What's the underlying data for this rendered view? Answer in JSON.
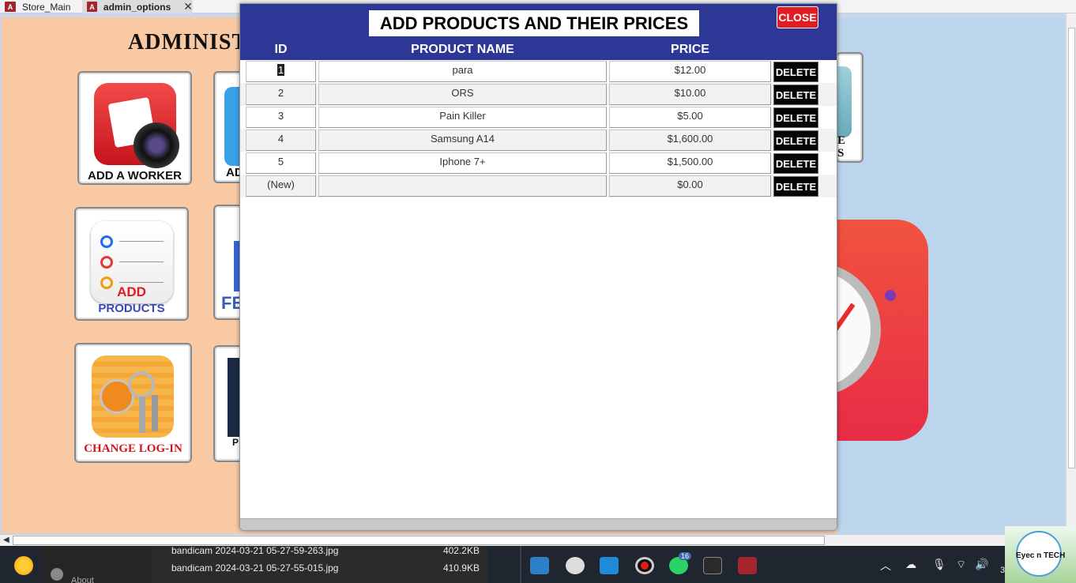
{
  "tabs": [
    {
      "label": "Store_Main",
      "icon": "access-icon"
    },
    {
      "label": "admin_options",
      "icon": "access-icon",
      "active": true
    }
  ],
  "background": {
    "title": "ADMINIST",
    "tiles": [
      {
        "label": "ADD A WORKER"
      },
      {
        "label": "AD"
      },
      {
        "label_line1": "ADD",
        "label_line2": "PRODUCTS"
      },
      {
        "label": "FE"
      },
      {
        "label": "CHANGE LOG-IN"
      },
      {
        "label": "P"
      },
      {
        "label_line1": "E",
        "label_line2": "S"
      }
    ]
  },
  "popup": {
    "title": "ADD PRODUCTS AND THEIR PRICES",
    "close_label": "CLOSE",
    "columns": {
      "id": "ID",
      "name": "PRODUCT NAME",
      "price": "PRICE"
    },
    "delete_label": "DELETE",
    "rows": [
      {
        "id": "1",
        "name": "para",
        "price": "$12.00"
      },
      {
        "id": "2",
        "name": "ORS",
        "price": "$10.00"
      },
      {
        "id": "3",
        "name": "Pain Killer",
        "price": "$5.00"
      },
      {
        "id": "4",
        "name": "Samsung A14",
        "price": "$1,600.00"
      },
      {
        "id": "5",
        "name": "Iphone 7+",
        "price": "$1,500.00"
      },
      {
        "id": "(New)",
        "name": "",
        "price": "$0.00"
      }
    ]
  },
  "explorer": {
    "files": [
      {
        "name": "bandicam 2024-03-21 05-27-59-263.jpg",
        "size": "402.2KB"
      },
      {
        "name": "bandicam 2024-03-21 05-27-55-015.jpg",
        "size": "410.9KB"
      }
    ],
    "side_item": "About"
  },
  "taskbar": {
    "whatsapp_badge": "16",
    "watermark_text": "Eyec  n TECH",
    "clock_partial": "3"
  }
}
